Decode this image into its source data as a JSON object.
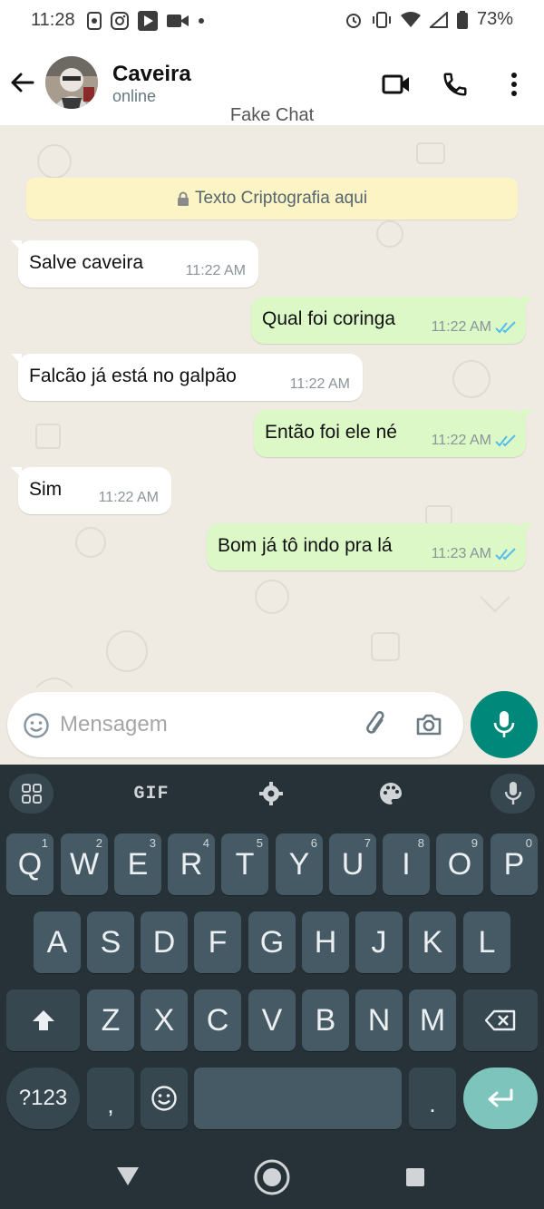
{
  "status_bar": {
    "time": "11:28",
    "battery": "73%",
    "left_icons": [
      "phone-sync-icon",
      "instagram-icon",
      "play-store-icon",
      "video-icon",
      "dot-icon"
    ],
    "right_icons": [
      "alarm-icon",
      "vibrate-icon",
      "wifi-icon",
      "signal-icon",
      "battery-icon"
    ]
  },
  "header": {
    "contact_name": "Caveira",
    "contact_status": "online",
    "subtitle": "Fake Chat"
  },
  "chat": {
    "encryption_notice": "Texto Criptografia aqui",
    "messages": [
      {
        "direction": "in",
        "text": "Salve caveira",
        "time": "11:22 AM"
      },
      {
        "direction": "out",
        "text": "Qual foi coringa",
        "time": "11:22 AM",
        "status": "read"
      },
      {
        "direction": "in",
        "text": "Falcão já está no galpão",
        "time": "11:22 AM"
      },
      {
        "direction": "out",
        "text": "Então foi ele né",
        "time": "11:22 AM",
        "status": "read"
      },
      {
        "direction": "in",
        "text": "Sim",
        "time": "11:22 AM"
      },
      {
        "direction": "out",
        "text": "Bom já tô indo pra lá",
        "time": "11:23 AM",
        "status": "read"
      }
    ]
  },
  "composer": {
    "placeholder": "Mensagem",
    "value": ""
  },
  "keyboard": {
    "toolbar_gif": "GIF",
    "row1": [
      "Q",
      "W",
      "E",
      "R",
      "T",
      "Y",
      "U",
      "I",
      "O",
      "P"
    ],
    "row1_hints": [
      "1",
      "2",
      "3",
      "4",
      "5",
      "6",
      "7",
      "8",
      "9",
      "0"
    ],
    "row2": [
      "A",
      "S",
      "D",
      "F",
      "G",
      "H",
      "J",
      "K",
      "L"
    ],
    "row3": [
      "Z",
      "X",
      "C",
      "V",
      "B",
      "N",
      "M"
    ],
    "symbols_key": "?123",
    "comma_key": ",",
    "period_key": "."
  },
  "colors": {
    "accent": "#00897b",
    "outgoing_bubble": "#dcf8c6",
    "read_ticks": "#53bdeb",
    "banner": "#fdf4c5",
    "keyboard_bg": "#263238"
  }
}
